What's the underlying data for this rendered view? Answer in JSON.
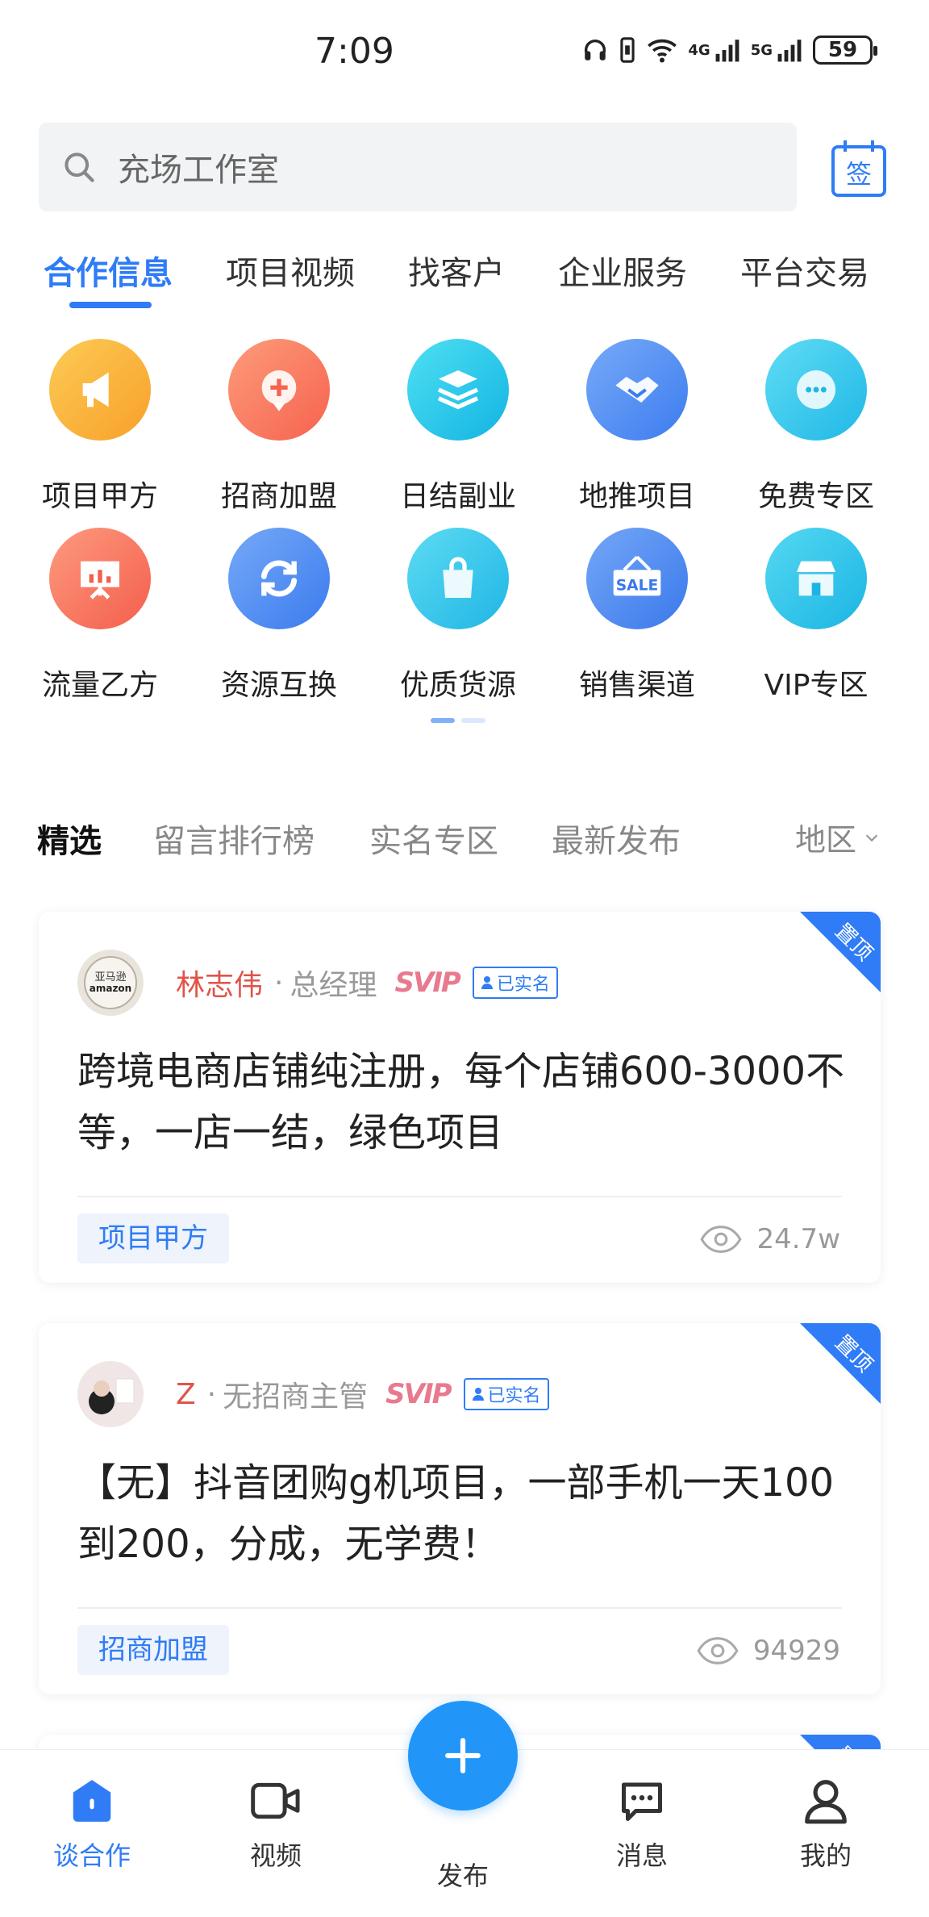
{
  "status_bar": {
    "time": "7:09",
    "battery": "59",
    "net1": "4G",
    "net2": "5G"
  },
  "search": {
    "placeholder": "充场工作室",
    "sign_label": "签"
  },
  "top_tabs": [
    "合作信息",
    "项目视频",
    "找客户",
    "企业服务",
    "平台交易"
  ],
  "categories": [
    {
      "label": "项目甲方",
      "icon": "megaphone-icon",
      "color": "#fbb33a"
    },
    {
      "label": "招商加盟",
      "icon": "map-pin-icon",
      "color": "#fa7d63"
    },
    {
      "label": "日结副业",
      "icon": "layers-icon",
      "color": "#24c7e8"
    },
    {
      "label": "地推项目",
      "icon": "handshake-icon",
      "color": "#4f8ef5"
    },
    {
      "label": "免费专区",
      "icon": "chat-bubble-icon",
      "color": "#37c9ec"
    },
    {
      "label": "流量乙方",
      "icon": "presentation-icon",
      "color": "#fa7663"
    },
    {
      "label": "资源互换",
      "icon": "refresh-icon",
      "color": "#4b8ff4"
    },
    {
      "label": "优质货源",
      "icon": "shopping-bag-icon",
      "color": "#38c8ea"
    },
    {
      "label": "销售渠道",
      "icon": "sale-sign-icon",
      "color": "#4f8ef5"
    },
    {
      "label": "VIP专区",
      "icon": "storefront-icon",
      "color": "#29c6ea"
    }
  ],
  "filters": {
    "tabs": [
      "精选",
      "留言排行榜",
      "实名专区",
      "最新发布"
    ],
    "region": "地区"
  },
  "posts": [
    {
      "pinned": "置顶",
      "name": "林志伟",
      "role": "总经理",
      "vip": "SVIP",
      "verified": "已实名",
      "title": "跨境电商店铺纯注册，每个店铺600-3000不等，一店一结，绿色项目",
      "tag": "项目甲方",
      "views": "24.7w"
    },
    {
      "pinned": "置顶",
      "name": "Z",
      "role": "无招商主管",
      "vip": "SVIP",
      "verified": "已实名",
      "title": "【无】抖音团购g机项目，一部手机一天100到200，分成，无学费！",
      "tag": "招商加盟",
      "views": "94929"
    }
  ],
  "third_card_pin": "置顶",
  "bottom_nav": {
    "talk": "谈合作",
    "video": "视频",
    "publish": "发布",
    "message": "消息",
    "mine": "我的"
  },
  "colors": {
    "accent": "#2f7cf6",
    "name_red": "#e0534a",
    "svip_pink": "#e87a8f"
  }
}
